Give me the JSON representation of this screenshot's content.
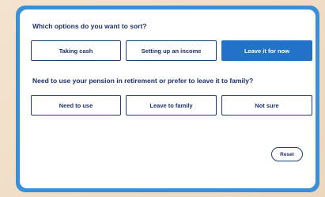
{
  "questions": [
    {
      "text": "Which options do you want to sort?",
      "options": [
        "Taking cash",
        "Setting up an income",
        "Leave it for now"
      ],
      "selected": "Leave it for now"
    },
    {
      "text": "Need to use your pension in retirement or prefer to leave it to family?",
      "options": [
        "Need to use",
        "Leave to family",
        "Not sure"
      ],
      "selected": ""
    }
  ],
  "reset_label": "Reset",
  "colors": {
    "accent": "#2272c9",
    "frame": "#3a8fd6",
    "text": "#1c2f6b",
    "background": "#f3e3cf"
  }
}
